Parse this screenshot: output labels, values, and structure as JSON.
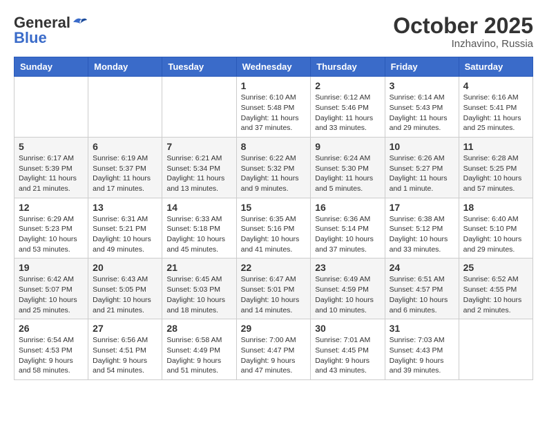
{
  "logo": {
    "general": "General",
    "blue": "Blue"
  },
  "title": "October 2025",
  "subtitle": "Inzhavino, Russia",
  "headers": [
    "Sunday",
    "Monday",
    "Tuesday",
    "Wednesday",
    "Thursday",
    "Friday",
    "Saturday"
  ],
  "weeks": [
    [
      {
        "day": "",
        "info": ""
      },
      {
        "day": "",
        "info": ""
      },
      {
        "day": "",
        "info": ""
      },
      {
        "day": "1",
        "info": "Sunrise: 6:10 AM\nSunset: 5:48 PM\nDaylight: 11 hours\nand 37 minutes."
      },
      {
        "day": "2",
        "info": "Sunrise: 6:12 AM\nSunset: 5:46 PM\nDaylight: 11 hours\nand 33 minutes."
      },
      {
        "day": "3",
        "info": "Sunrise: 6:14 AM\nSunset: 5:43 PM\nDaylight: 11 hours\nand 29 minutes."
      },
      {
        "day": "4",
        "info": "Sunrise: 6:16 AM\nSunset: 5:41 PM\nDaylight: 11 hours\nand 25 minutes."
      }
    ],
    [
      {
        "day": "5",
        "info": "Sunrise: 6:17 AM\nSunset: 5:39 PM\nDaylight: 11 hours\nand 21 minutes."
      },
      {
        "day": "6",
        "info": "Sunrise: 6:19 AM\nSunset: 5:37 PM\nDaylight: 11 hours\nand 17 minutes."
      },
      {
        "day": "7",
        "info": "Sunrise: 6:21 AM\nSunset: 5:34 PM\nDaylight: 11 hours\nand 13 minutes."
      },
      {
        "day": "8",
        "info": "Sunrise: 6:22 AM\nSunset: 5:32 PM\nDaylight: 11 hours\nand 9 minutes."
      },
      {
        "day": "9",
        "info": "Sunrise: 6:24 AM\nSunset: 5:30 PM\nDaylight: 11 hours\nand 5 minutes."
      },
      {
        "day": "10",
        "info": "Sunrise: 6:26 AM\nSunset: 5:27 PM\nDaylight: 11 hours\nand 1 minute."
      },
      {
        "day": "11",
        "info": "Sunrise: 6:28 AM\nSunset: 5:25 PM\nDaylight: 10 hours\nand 57 minutes."
      }
    ],
    [
      {
        "day": "12",
        "info": "Sunrise: 6:29 AM\nSunset: 5:23 PM\nDaylight: 10 hours\nand 53 minutes."
      },
      {
        "day": "13",
        "info": "Sunrise: 6:31 AM\nSunset: 5:21 PM\nDaylight: 10 hours\nand 49 minutes."
      },
      {
        "day": "14",
        "info": "Sunrise: 6:33 AM\nSunset: 5:18 PM\nDaylight: 10 hours\nand 45 minutes."
      },
      {
        "day": "15",
        "info": "Sunrise: 6:35 AM\nSunset: 5:16 PM\nDaylight: 10 hours\nand 41 minutes."
      },
      {
        "day": "16",
        "info": "Sunrise: 6:36 AM\nSunset: 5:14 PM\nDaylight: 10 hours\nand 37 minutes."
      },
      {
        "day": "17",
        "info": "Sunrise: 6:38 AM\nSunset: 5:12 PM\nDaylight: 10 hours\nand 33 minutes."
      },
      {
        "day": "18",
        "info": "Sunrise: 6:40 AM\nSunset: 5:10 PM\nDaylight: 10 hours\nand 29 minutes."
      }
    ],
    [
      {
        "day": "19",
        "info": "Sunrise: 6:42 AM\nSunset: 5:07 PM\nDaylight: 10 hours\nand 25 minutes."
      },
      {
        "day": "20",
        "info": "Sunrise: 6:43 AM\nSunset: 5:05 PM\nDaylight: 10 hours\nand 21 minutes."
      },
      {
        "day": "21",
        "info": "Sunrise: 6:45 AM\nSunset: 5:03 PM\nDaylight: 10 hours\nand 18 minutes."
      },
      {
        "day": "22",
        "info": "Sunrise: 6:47 AM\nSunset: 5:01 PM\nDaylight: 10 hours\nand 14 minutes."
      },
      {
        "day": "23",
        "info": "Sunrise: 6:49 AM\nSunset: 4:59 PM\nDaylight: 10 hours\nand 10 minutes."
      },
      {
        "day": "24",
        "info": "Sunrise: 6:51 AM\nSunset: 4:57 PM\nDaylight: 10 hours\nand 6 minutes."
      },
      {
        "day": "25",
        "info": "Sunrise: 6:52 AM\nSunset: 4:55 PM\nDaylight: 10 hours\nand 2 minutes."
      }
    ],
    [
      {
        "day": "26",
        "info": "Sunrise: 6:54 AM\nSunset: 4:53 PM\nDaylight: 9 hours\nand 58 minutes."
      },
      {
        "day": "27",
        "info": "Sunrise: 6:56 AM\nSunset: 4:51 PM\nDaylight: 9 hours\nand 54 minutes."
      },
      {
        "day": "28",
        "info": "Sunrise: 6:58 AM\nSunset: 4:49 PM\nDaylight: 9 hours\nand 51 minutes."
      },
      {
        "day": "29",
        "info": "Sunrise: 7:00 AM\nSunset: 4:47 PM\nDaylight: 9 hours\nand 47 minutes."
      },
      {
        "day": "30",
        "info": "Sunrise: 7:01 AM\nSunset: 4:45 PM\nDaylight: 9 hours\nand 43 minutes."
      },
      {
        "day": "31",
        "info": "Sunrise: 7:03 AM\nSunset: 4:43 PM\nDaylight: 9 hours\nand 39 minutes."
      },
      {
        "day": "",
        "info": ""
      }
    ]
  ]
}
